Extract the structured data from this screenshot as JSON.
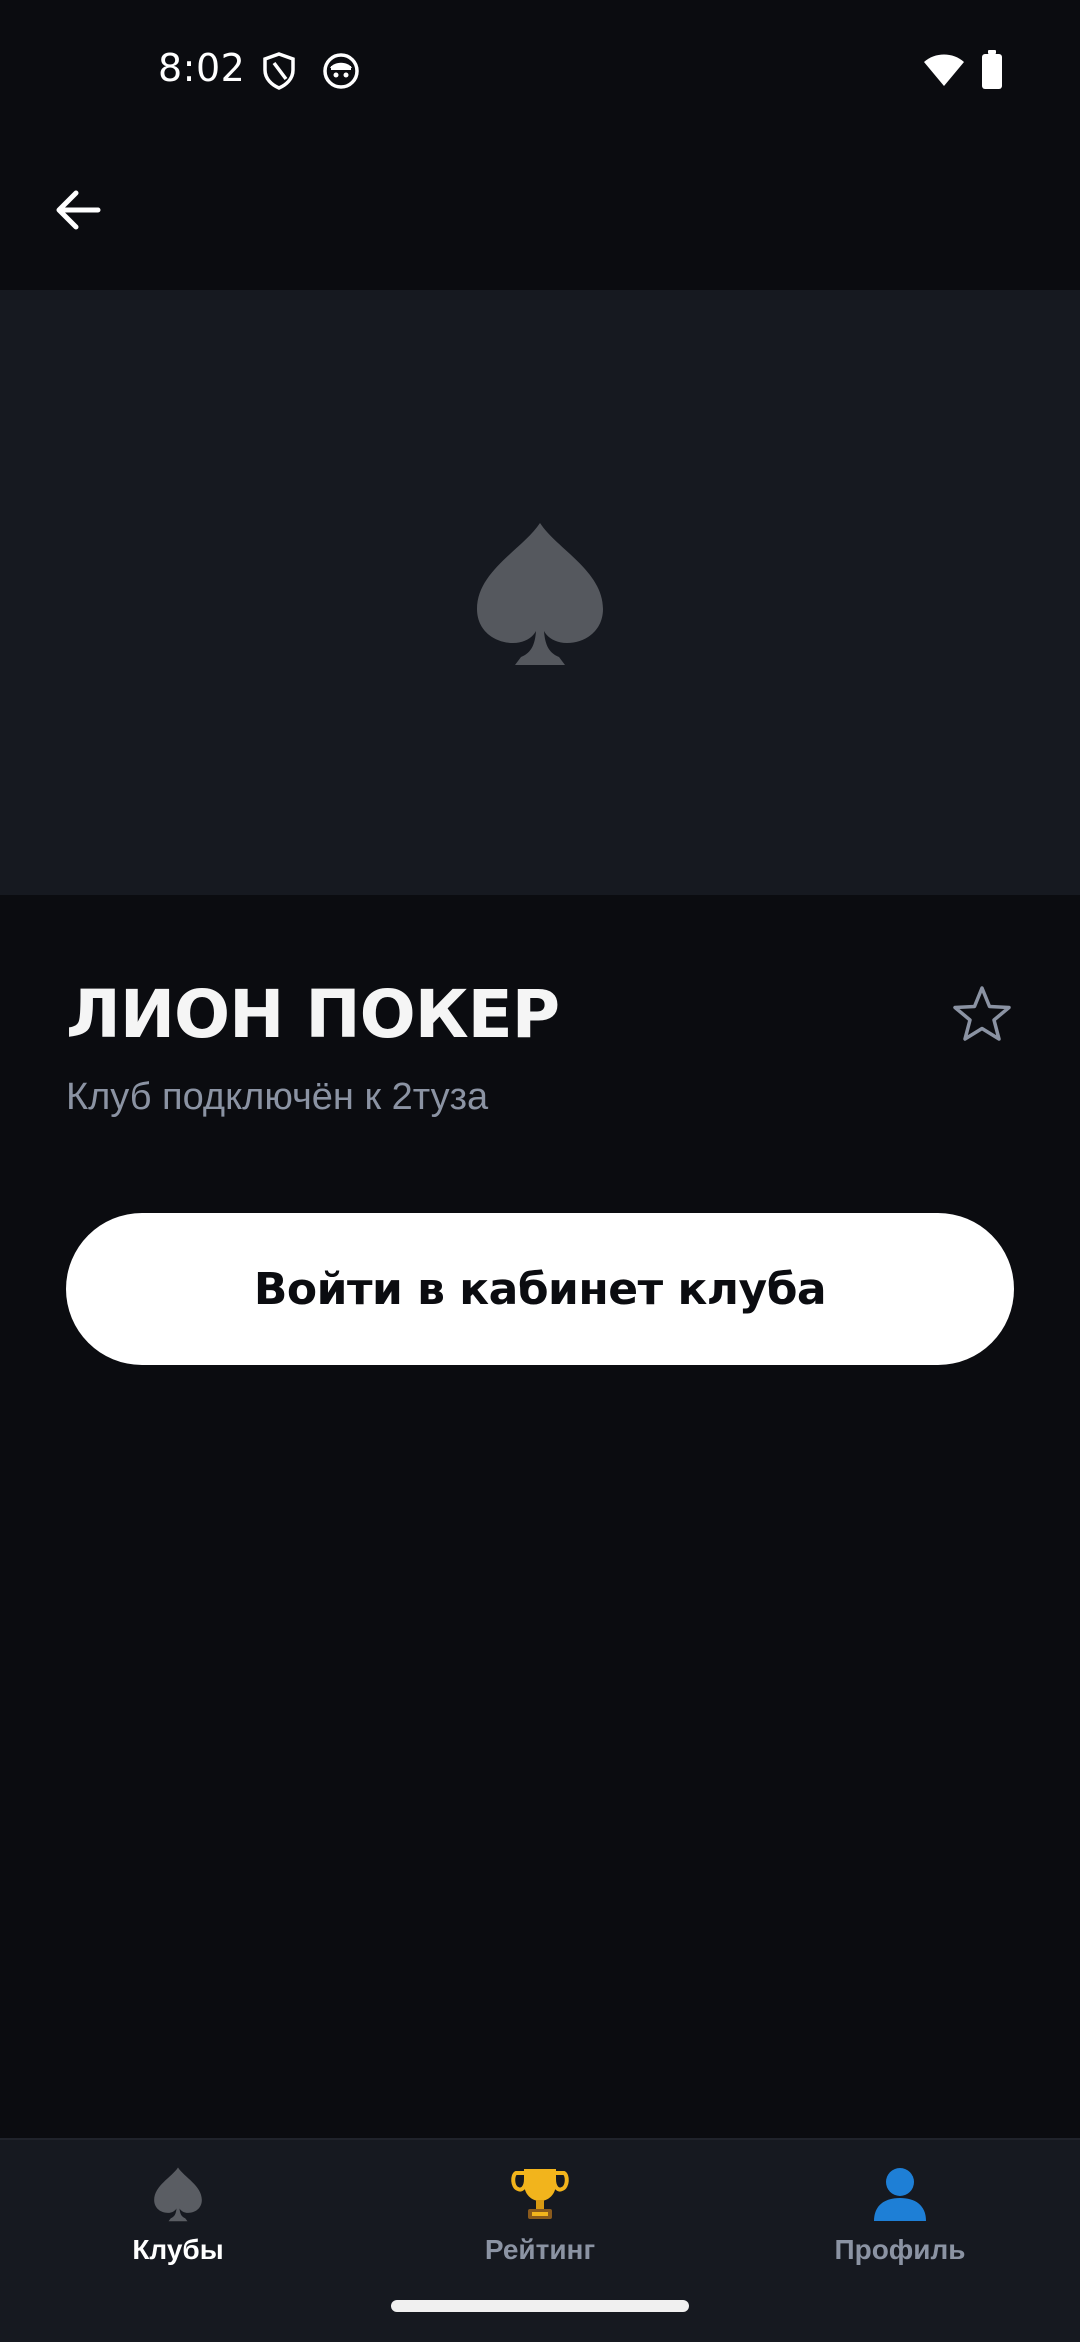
{
  "status_bar": {
    "time": "8:02",
    "icons": [
      "shield-icon",
      "cookie-face-icon",
      "wifi-icon",
      "battery-icon"
    ]
  },
  "top_bar": {
    "back_icon": "arrow-left-icon"
  },
  "banner": {
    "icon": "spade-icon",
    "icon_color": "#55585e",
    "background": "#161920"
  },
  "club": {
    "title": "ЛИОН ПОКЕР",
    "subtitle": "Клуб подключён к 2туза",
    "favorite_icon": "star-outline-icon"
  },
  "cta": {
    "label": "Войти в кабинет клуба"
  },
  "bottom_nav": {
    "items": [
      {
        "label": "Клубы",
        "icon": "spade-icon",
        "active": true
      },
      {
        "label": "Рейтинг",
        "icon": "trophy-icon",
        "active": false
      },
      {
        "label": "Профиль",
        "icon": "person-icon",
        "active": false
      }
    ]
  },
  "colors": {
    "background": "#0b0c10",
    "surface": "#161920",
    "accent_text": "#ffffff",
    "muted_text": "#8b93a3",
    "profile_icon": "#1e7fd6",
    "trophy_icon": "#f2b41c"
  }
}
